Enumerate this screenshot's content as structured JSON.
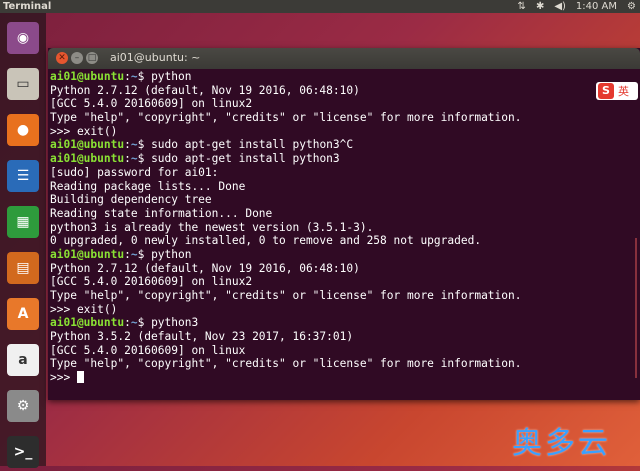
{
  "panel": {
    "app_name": "Terminal",
    "clock": "1:40 AM"
  },
  "window": {
    "title": "ai01@ubuntu: ~"
  },
  "terminal": {
    "user_host": "ai01@ubuntu",
    "path": "~",
    "lines": [
      {
        "type": "prompt",
        "cmd": "$ python"
      },
      {
        "type": "out",
        "text": "Python 2.7.12 (default, Nov 19 2016, 06:48:10)"
      },
      {
        "type": "out",
        "text": "[GCC 5.4.0 20160609] on linux2"
      },
      {
        "type": "out",
        "text": "Type \"help\", \"copyright\", \"credits\" or \"license\" for more information."
      },
      {
        "type": "out",
        "text": ">>> exit()"
      },
      {
        "type": "prompt",
        "cmd": "$ sudo apt-get install python3^C"
      },
      {
        "type": "prompt",
        "cmd": "$ sudo apt-get install python3"
      },
      {
        "type": "out",
        "text": "[sudo] password for ai01:"
      },
      {
        "type": "out",
        "text": "Reading package lists... Done"
      },
      {
        "type": "out",
        "text": "Building dependency tree"
      },
      {
        "type": "out",
        "text": "Reading state information... Done"
      },
      {
        "type": "out",
        "text": "python3 is already the newest version (3.5.1-3)."
      },
      {
        "type": "out",
        "text": "0 upgraded, 0 newly installed, 0 to remove and 258 not upgraded."
      },
      {
        "type": "prompt",
        "cmd": "$ python"
      },
      {
        "type": "out",
        "text": "Python 2.7.12 (default, Nov 19 2016, 06:48:10)"
      },
      {
        "type": "out",
        "text": "[GCC 5.4.0 20160609] on linux2"
      },
      {
        "type": "out",
        "text": "Type \"help\", \"copyright\", \"credits\" or \"license\" for more information."
      },
      {
        "type": "out",
        "text": ">>> exit()"
      },
      {
        "type": "prompt",
        "cmd": "$ python3"
      },
      {
        "type": "out",
        "text": "Python 3.5.2 (default, Nov 23 2017, 16:37:01)"
      },
      {
        "type": "out",
        "text": "[GCC 5.4.0 20160609] on linux"
      },
      {
        "type": "out",
        "text": "Type \"help\", \"copyright\", \"credits\" or \"license\" for more information."
      },
      {
        "type": "cursor",
        "text": ">>> "
      }
    ]
  },
  "launcher": {
    "items": [
      {
        "name": "ubuntu-dash-icon",
        "color": "#8b4a8a"
      },
      {
        "name": "files-icon",
        "color": "#c9c4b8"
      },
      {
        "name": "firefox-icon",
        "color": "#e8711e"
      },
      {
        "name": "writer-icon",
        "color": "#2a6bb8"
      },
      {
        "name": "calc-icon",
        "color": "#2e9b3c"
      },
      {
        "name": "impress-icon",
        "color": "#d2691e"
      },
      {
        "name": "software-center-icon",
        "color": "#e8782a"
      },
      {
        "name": "amazon-icon",
        "color": "#f0f0f0"
      },
      {
        "name": "settings-icon",
        "color": "#8a8a8a"
      },
      {
        "name": "terminal-icon",
        "color": "#2d2d2d"
      }
    ]
  },
  "ime": {
    "logo": "S",
    "lang": "英"
  },
  "watermark": "奥多云",
  "colors": {
    "terminal_bg": "#300a24",
    "prompt_user": "#8ae234",
    "prompt_path": "#729fcf"
  }
}
